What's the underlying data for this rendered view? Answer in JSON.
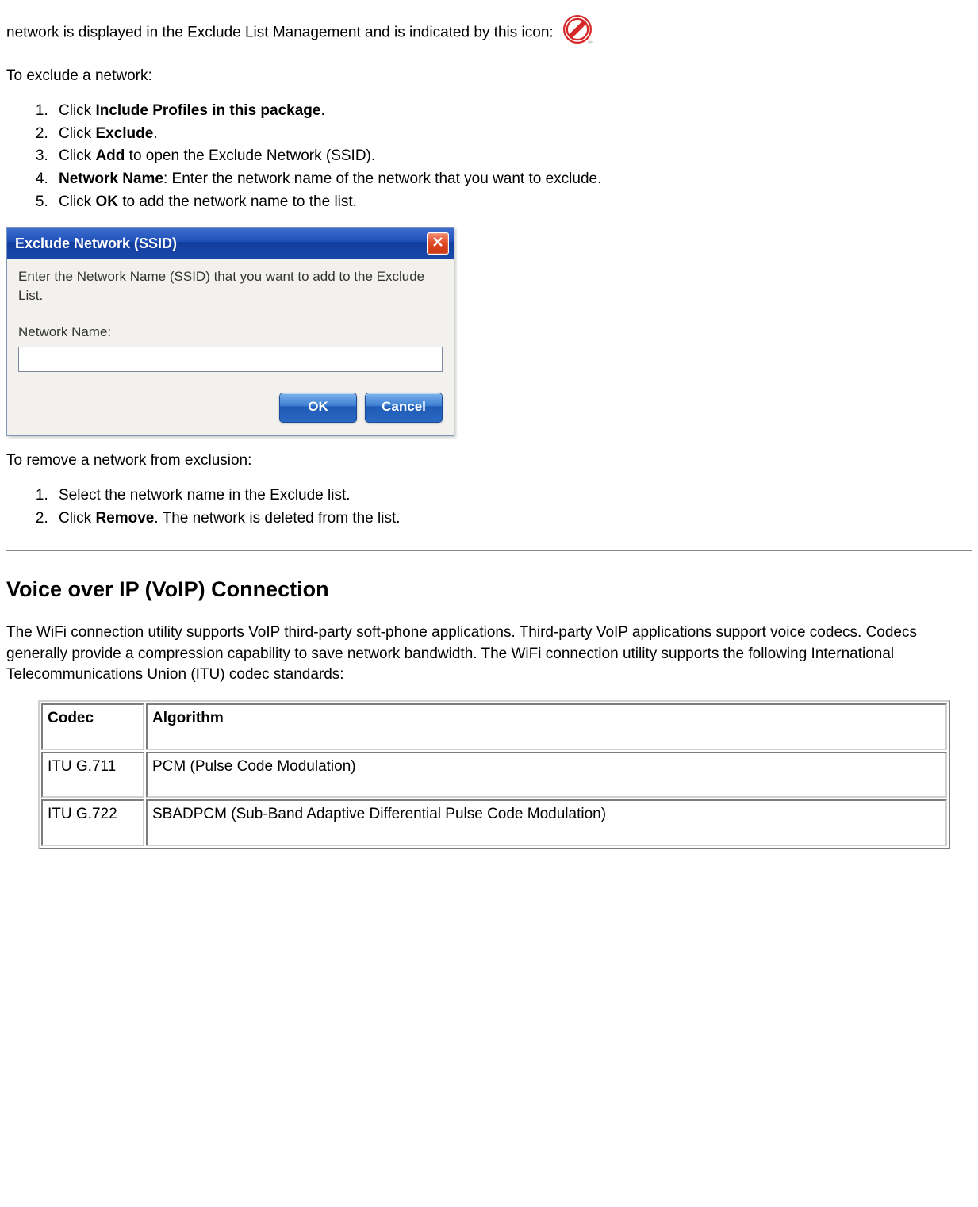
{
  "intro": {
    "line_prefix": "network is displayed in the Exclude List Management and is indicated by this icon:"
  },
  "exclude": {
    "heading": "To exclude a network:",
    "steps": {
      "s1_pre": "Click ",
      "s1_bold": "Include Profiles in this package",
      "s1_post": ".",
      "s2_pre": "Click ",
      "s2_bold": "Exclude",
      "s2_post": ".",
      "s3_pre": "Click ",
      "s3_bold": "Add",
      "s3_post": " to open the Exclude Network (SSID).",
      "s4_bold": "Network Name",
      "s4_post": ": Enter the network name of the network that you want to exclude.",
      "s5_pre": "Click ",
      "s5_bold": "OK",
      "s5_post": " to add the network name to the list."
    }
  },
  "dialog": {
    "title": "Exclude Network (SSID)",
    "instruction": "Enter the Network Name (SSID) that you want to add to the Exclude List.",
    "field_label": "Network Name:",
    "input_value": "",
    "ok": "OK",
    "cancel": "Cancel"
  },
  "remove": {
    "heading": "To remove a network from exclusion:",
    "steps": {
      "s1": "Select the network name in the Exclude list.",
      "s2_pre": "Click ",
      "s2_bold": "Remove",
      "s2_post": ". The network is deleted from the list."
    }
  },
  "voip": {
    "heading": "Voice over IP (VoIP) Connection",
    "paragraph": "The WiFi connection utility supports VoIP third-party soft-phone applications. Third-party VoIP applications support voice codecs. Codecs generally provide a compression capability to save network bandwidth. The WiFi connection utility supports the following International Telecommunications Union (ITU) codec standards:",
    "table": {
      "head_codec": "Codec",
      "head_algo": "Algorithm",
      "rows": [
        {
          "codec": "ITU G.711",
          "algo": "PCM (Pulse Code Modulation)"
        },
        {
          "codec": "ITU G.722",
          "algo": "SBADPCM (Sub-Band Adaptive Differential Pulse Code Modulation)"
        }
      ]
    }
  }
}
